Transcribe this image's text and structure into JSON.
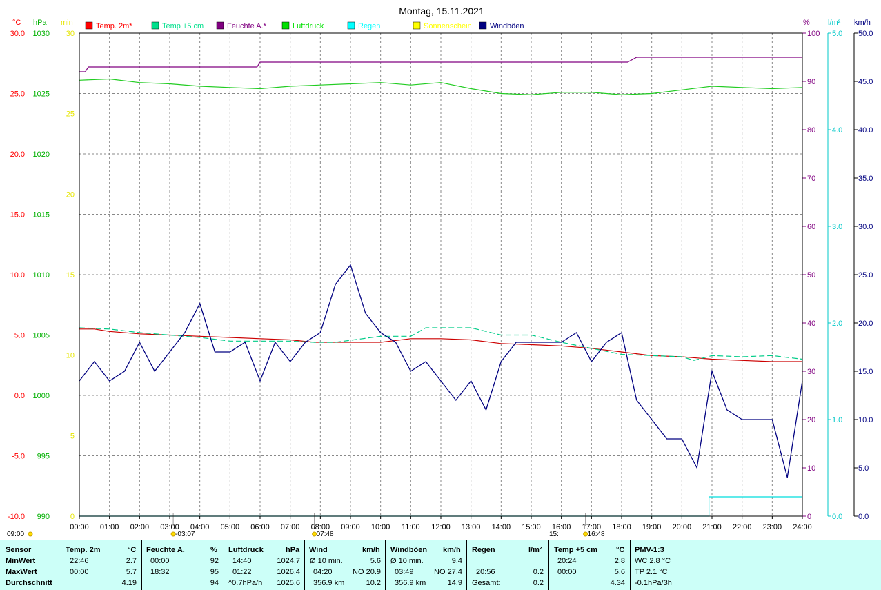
{
  "title": "Montag, 15.11.2021",
  "axes": {
    "temp": {
      "unit": "°C",
      "ticks": [
        "30.0",
        "25.0",
        "20.0",
        "15.0",
        "10.0",
        "5.0",
        "0.0",
        "-5.0",
        "-10.0"
      ],
      "color": "#ff0000"
    },
    "press": {
      "unit": "hPa",
      "ticks": [
        "1030",
        "1025",
        "1020",
        "1015",
        "1010",
        "1005",
        "1000",
        "995",
        "990"
      ],
      "color": "#00b000"
    },
    "sun": {
      "unit": "min",
      "ticks": [
        "30",
        "25",
        "20",
        "15",
        "10",
        "5",
        "0"
      ],
      "color": "#e6e600"
    },
    "hum": {
      "unit": "%",
      "ticks": [
        "100",
        "90",
        "80",
        "70",
        "60",
        "50",
        "40",
        "30",
        "20",
        "10",
        "0"
      ],
      "color": "#800080"
    },
    "rain": {
      "unit": "l/m²",
      "ticks": [
        "5.0",
        "4.0",
        "3.0",
        "2.0",
        "1.0",
        "0.0"
      ],
      "color": "#00c8c8"
    },
    "wind": {
      "unit": "km/h",
      "ticks": [
        "50.0",
        "45.0",
        "40.0",
        "35.0",
        "30.0",
        "25.0",
        "20.0",
        "15.0",
        "10.0",
        "5.0",
        "0.0"
      ],
      "color": "#000080"
    }
  },
  "legend": [
    {
      "label": "Temp. 2m*",
      "color": "#ff0000"
    },
    {
      "label": "Temp +5 cm",
      "color": "#00e08c"
    },
    {
      "label": "Feuchte A.*",
      "color": "#800080"
    },
    {
      "label": "Luftdruck",
      "color": "#00e000"
    },
    {
      "label": "Regen",
      "color": "#00ffff"
    },
    {
      "label": "Sonnenschein",
      "color": "#ffff00"
    },
    {
      "label": "Windböen",
      "color": "#000080"
    }
  ],
  "x_ticks": [
    "00:00",
    "01:00",
    "02:00",
    "03:00",
    "04:00",
    "05:00",
    "06:00",
    "07:00",
    "08:00",
    "09:00",
    "10:00",
    "11:00",
    "12:00",
    "13:00",
    "14:00",
    "15:00",
    "16:00",
    "17:00",
    "18:00",
    "19:00",
    "20:00",
    "21:00",
    "22:00",
    "23:00",
    "24:00"
  ],
  "markers": {
    "moonset": "09:00",
    "moonrise_mark": "-03:07",
    "sunrise": "07:48",
    "moon2": "15:",
    "sunset": "16:48"
  },
  "chart_data": {
    "type": "line",
    "title": "Montag, 15.11.2021",
    "x_hours": [
      0,
      24
    ],
    "series": [
      {
        "name": "Temp. 2m*",
        "unit": "°C",
        "axis_range": [
          -10,
          30
        ],
        "x": [
          0,
          0.5,
          1,
          2,
          3,
          4,
          5,
          6,
          7,
          7.8,
          9,
          10,
          11,
          12,
          13,
          14,
          15,
          16,
          17,
          18,
          19,
          20,
          21,
          22,
          23,
          24
        ],
        "y": [
          5.5,
          5.5,
          5.3,
          5.1,
          5.0,
          4.9,
          4.8,
          4.7,
          4.6,
          4.4,
          4.4,
          4.4,
          4.7,
          4.7,
          4.6,
          4.3,
          4.2,
          4.1,
          3.9,
          3.6,
          3.3,
          3.2,
          3.0,
          2.9,
          2.8,
          2.8
        ]
      },
      {
        "name": "Temp +5 cm",
        "unit": "°C",
        "axis_range": [
          -10,
          30
        ],
        "x": [
          0,
          1,
          2,
          3,
          4,
          5,
          6,
          7,
          7.8,
          8.5,
          10,
          11,
          11.5,
          12,
          13,
          14,
          15,
          16,
          17,
          18,
          19,
          20,
          20.4,
          21,
          22,
          23,
          24
        ],
        "y": [
          5.6,
          5.5,
          5.2,
          5.0,
          4.8,
          4.5,
          4.5,
          4.5,
          4.4,
          4.4,
          4.9,
          4.9,
          5.6,
          5.6,
          5.6,
          5.0,
          5.0,
          4.4,
          3.9,
          3.4,
          3.3,
          3.2,
          2.9,
          3.3,
          3.2,
          3.3,
          3.0
        ]
      },
      {
        "name": "Feuchte A.*",
        "unit": "%",
        "axis_range": [
          0,
          100
        ],
        "x": [
          0,
          0.2,
          0.3,
          1,
          2,
          3,
          4,
          5,
          5.9,
          6,
          7,
          8,
          10,
          12,
          14,
          16,
          18,
          18.2,
          18.5,
          19,
          19.3,
          19.5,
          20,
          21,
          22,
          23,
          24
        ],
        "y": [
          92,
          92,
          93,
          93,
          93,
          93,
          93,
          93,
          93,
          94,
          94,
          94,
          94,
          94,
          94,
          94,
          94,
          94,
          95,
          95,
          95,
          95,
          95,
          95,
          95,
          95,
          95
        ]
      },
      {
        "name": "Luftdruck",
        "unit": "hPa",
        "axis_range": [
          990,
          1030
        ],
        "x": [
          0,
          1,
          2,
          3,
          4,
          5,
          6,
          7,
          8,
          9,
          10,
          11,
          12,
          13,
          14,
          15,
          16,
          17,
          18,
          19,
          20,
          21,
          22,
          23,
          24
        ],
        "y": [
          1026.1,
          1026.2,
          1025.9,
          1025.8,
          1025.6,
          1025.5,
          1025.4,
          1025.6,
          1025.7,
          1025.8,
          1025.9,
          1025.7,
          1025.9,
          1025.4,
          1025.0,
          1024.9,
          1025.1,
          1025.1,
          1024.9,
          1025.0,
          1025.3,
          1025.6,
          1025.5,
          1025.4,
          1025.5
        ]
      },
      {
        "name": "Regen",
        "unit": "l/m²",
        "axis_range": [
          0,
          5
        ],
        "x": [
          0,
          20.9,
          20.9,
          24
        ],
        "y": [
          0,
          0,
          0.2,
          0.2
        ]
      },
      {
        "name": "Windböen",
        "unit": "km/h",
        "axis_range": [
          0,
          50
        ],
        "x": [
          0,
          0.5,
          1,
          1.5,
          2,
          2.5,
          3,
          3.5,
          4,
          4.5,
          5,
          5.5,
          6,
          6.5,
          7,
          7.5,
          8,
          8.5,
          9,
          9.5,
          10,
          10.5,
          11,
          11.5,
          12,
          12.5,
          13,
          13.5,
          14,
          14.5,
          15,
          15.5,
          16,
          16.5,
          17,
          17.5,
          18,
          18.5,
          19,
          19.5,
          20,
          20.5,
          21,
          21.5,
          22,
          22.5,
          23,
          23.5,
          24
        ],
        "y": [
          14,
          16,
          14,
          15,
          18,
          15,
          17,
          19,
          22,
          17,
          17,
          18,
          14,
          18,
          16,
          18,
          19,
          24,
          26,
          21,
          19,
          18,
          15,
          16,
          14,
          12,
          14,
          11,
          16,
          18,
          18,
          18,
          18,
          19,
          16,
          18,
          19,
          12,
          10,
          8,
          8,
          5,
          15,
          11,
          10,
          10,
          10,
          4,
          14
        ]
      }
    ],
    "marks": [
      {
        "time": "03:07",
        "label": "-03:07"
      },
      {
        "time": "07:48",
        "label": "07:48"
      },
      {
        "time": "16:48",
        "label": "16:48"
      }
    ]
  },
  "table": {
    "col_headers": [
      "Sensor",
      "Temp. 2m",
      "°C",
      "Feuchte A.",
      "%",
      "Luftdruck",
      "hPa",
      "Wind",
      "km/h",
      "Windböen",
      "km/h",
      "Regen",
      "l/m²",
      "Temp +5 cm",
      "°C",
      "PMV-1:3"
    ],
    "row_labels": [
      "MinWert",
      "MaxWert",
      "Durchschnitt"
    ],
    "temp2m": {
      "min_time": "22:46",
      "min": "2.7",
      "max_time": "00:00",
      "max": "5.7",
      "avg": "4.19"
    },
    "hum": {
      "min_time": "00:00",
      "min": "92",
      "max_time": "18:32",
      "max": "95",
      "avg": "94"
    },
    "press": {
      "min_time": "14:40",
      "min": "1024.7",
      "max_time": "01:22",
      "max": "1026.4",
      "avg_label": "^0.7hPa/h",
      "avg": "1025.6"
    },
    "wind": {
      "min_label": "Ø 10 min.",
      "min": "5.6",
      "max_time": "04:20",
      "max": "NO 20.9",
      "avg_label": "356.9 km",
      "avg": "10.2"
    },
    "gust": {
      "min_label": "Ø 10 min.",
      "min": "9.4",
      "max_time": "03:49",
      "max": "NO 27.4",
      "avg_label": "356.9 km",
      "avg": "14.9"
    },
    "rain": {
      "max_time": "20:56",
      "max": "0.2",
      "total_label": "Gesamt:",
      "total": "0.2"
    },
    "temp5": {
      "min_time": "20:24",
      "min": "2.8",
      "max_time": "00:00",
      "max": "5.6",
      "avg": "4.34"
    },
    "pmv": {
      "r1": "WC 2.8 °C",
      "r2": "TP 2.1 °C",
      "r3": "-0.1hPa/3h"
    }
  }
}
